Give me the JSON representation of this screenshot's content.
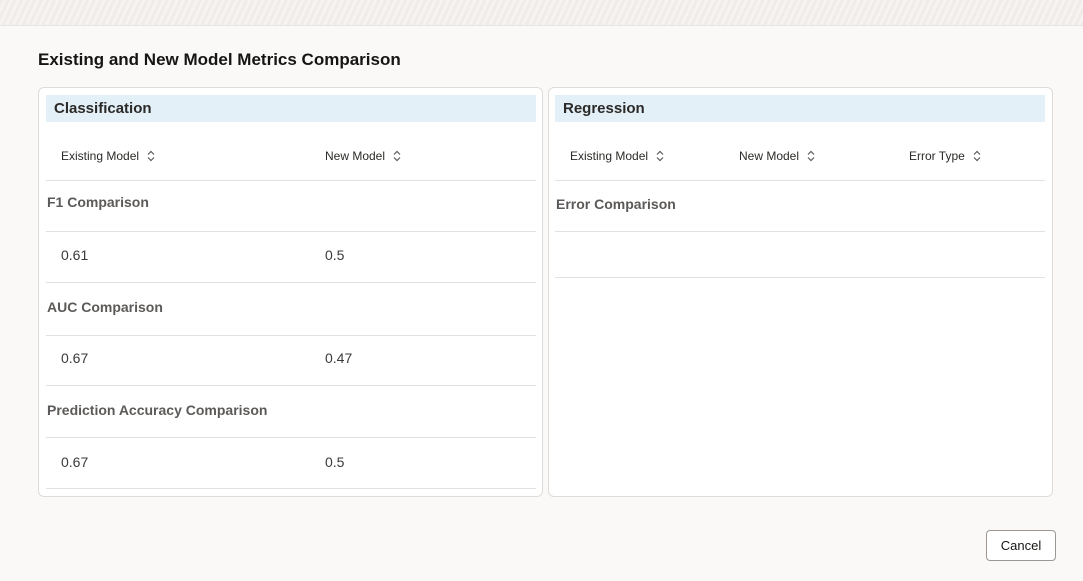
{
  "dialog": {
    "title": "Existing and New Model Metrics Comparison"
  },
  "classification": {
    "title": "Classification",
    "columns": [
      "Existing Model",
      "New Model"
    ],
    "groups": [
      {
        "label": "F1 Comparison",
        "existing": "0.61",
        "new": "0.5"
      },
      {
        "label": "AUC Comparison",
        "existing": "0.67",
        "new": "0.47"
      },
      {
        "label": "Prediction Accuracy Comparison",
        "existing": "0.67",
        "new": "0.5"
      }
    ]
  },
  "regression": {
    "title": "Regression",
    "columns": [
      "Existing Model",
      "New Model",
      "Error Type"
    ],
    "groups": [
      {
        "label": "Error Comparison"
      }
    ]
  },
  "footer": {
    "cancel_label": "Cancel"
  },
  "icons": {
    "sort": "sort-icon"
  }
}
